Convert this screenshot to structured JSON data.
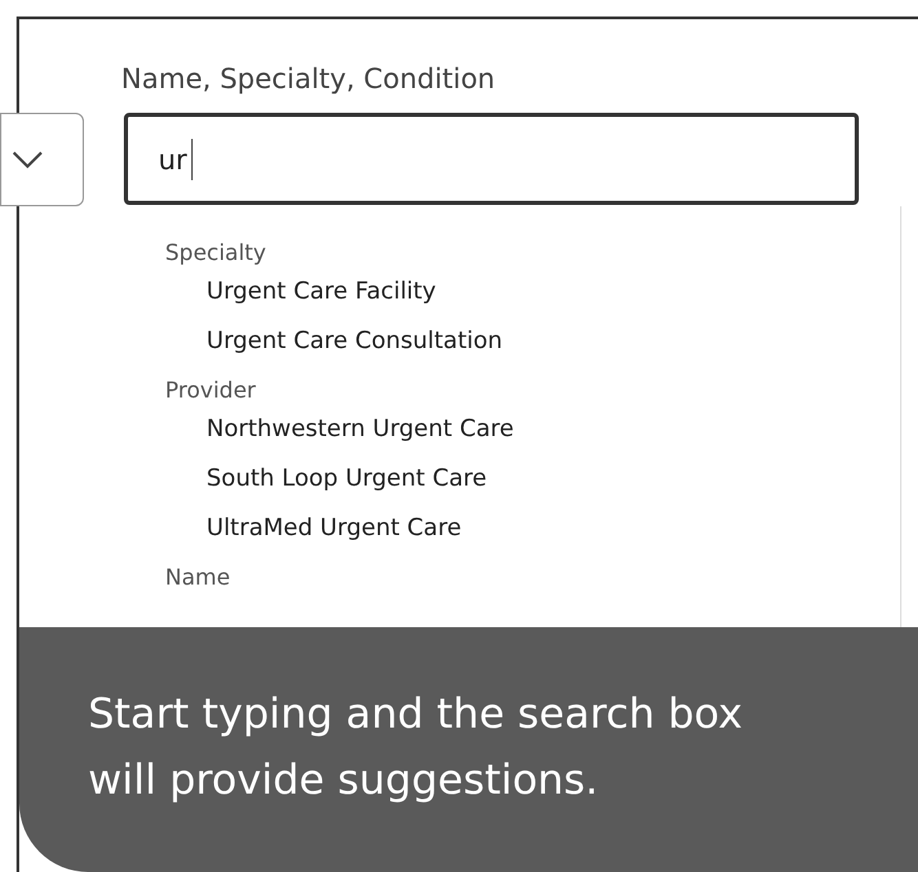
{
  "search": {
    "label": "Name, Specialty, Condition",
    "value": "ur"
  },
  "suggestions": [
    {
      "heading": "Specialty",
      "items": [
        "Urgent Care Facility",
        "Urgent Care Consultation"
      ]
    },
    {
      "heading": "Provider",
      "items": [
        "Northwestern Urgent Care",
        "South Loop Urgent Care",
        "UltraMed Urgent Care"
      ]
    },
    {
      "heading": "Name"
    }
  ],
  "caption": "Start typing and the search box will provide suggestions."
}
